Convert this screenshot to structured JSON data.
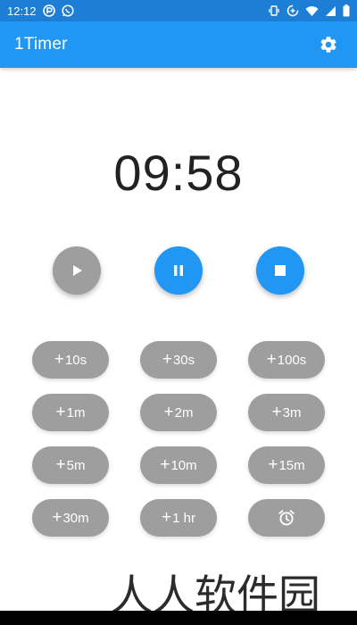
{
  "status_bar": {
    "time": "12:12",
    "icons": [
      "app-notification-icon",
      "whatsapp-icon",
      "vibrate-icon",
      "data-saver-icon",
      "wifi-icon",
      "signal-icon",
      "battery-icon"
    ]
  },
  "app_bar": {
    "title": "1Timer",
    "settings_icon": "gear-icon"
  },
  "timer": {
    "display": "09:58"
  },
  "controls": {
    "play_icon": "play-icon",
    "pause_icon": "pause-icon",
    "stop_icon": "stop-icon"
  },
  "quick_add": {
    "plus": "+",
    "buttons": [
      "10s",
      "30s",
      "100s",
      "1m",
      "2m",
      "3m",
      "5m",
      "10m",
      "15m",
      "30m",
      "1 hr"
    ],
    "alarm_icon": "alarm-clock-icon"
  },
  "watermark": {
    "text": "人人软件园"
  },
  "colors": {
    "primary": "#2196f3",
    "status_bar": "#1d7ed6",
    "inactive_button": "#9e9e9e",
    "timer_text": "#222222"
  }
}
